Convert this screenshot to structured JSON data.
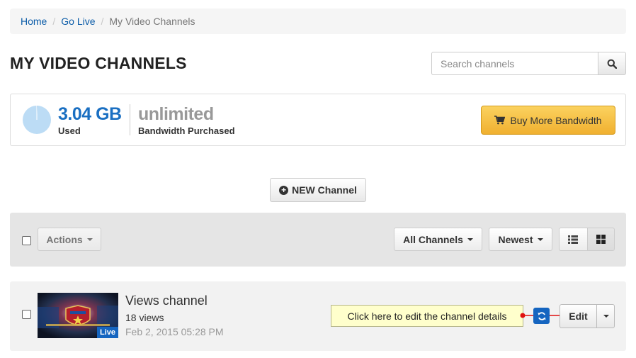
{
  "breadcrumb": {
    "items": [
      "Home",
      "Go Live"
    ],
    "current": "My Video Channels"
  },
  "page": {
    "title": "MY VIDEO CHANNELS"
  },
  "search": {
    "placeholder": "Search channels",
    "icon": "search-icon"
  },
  "bandwidth": {
    "used_value": "3.04 GB",
    "used_label": "Used",
    "used_fraction": 0.01,
    "purchased_value": "unlimited",
    "purchased_label": "Bandwidth Purchased",
    "buy_label": "Buy More Bandwidth",
    "buy_icon": "shopping-cart-icon",
    "pie_color": "#bcdcf5"
  },
  "new_channel": {
    "label": "NEW Channel",
    "icon": "plus-circle-icon"
  },
  "toolbar": {
    "actions_label": "Actions",
    "filter_label": "All Channels",
    "sort_label": "Newest",
    "views": [
      "list-view-icon",
      "grid-view-icon"
    ]
  },
  "channels": [
    {
      "name": "Views channel",
      "views": "18 views",
      "date": "Feb 2, 2015 05:28 PM",
      "badge": "Live",
      "edit_label": "Edit",
      "tooltip": "Click here to edit the channel details"
    }
  ],
  "colors": {
    "link": "#0b5ca8",
    "accent": "#1a6fc2",
    "buy_button": "#f5c04a",
    "live_badge": "#1565c0",
    "tooltip_bg": "#ffffcc",
    "annotation": "#e01010"
  }
}
